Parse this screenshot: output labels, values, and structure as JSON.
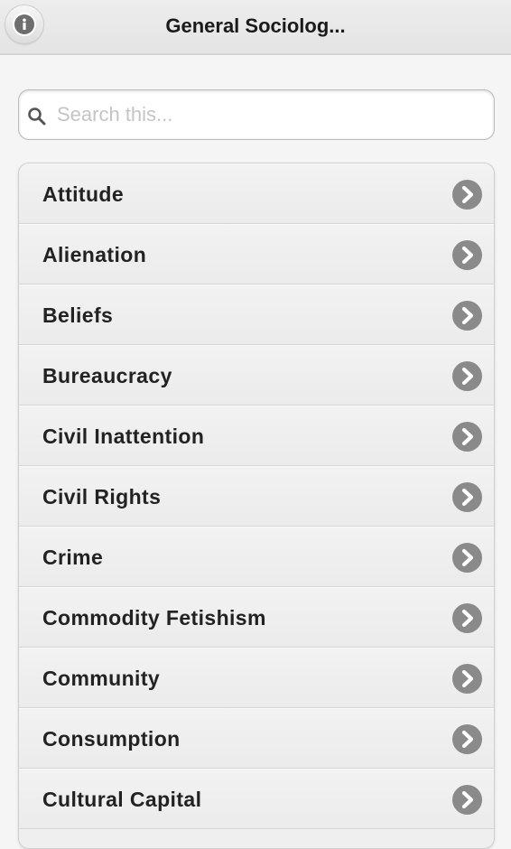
{
  "header": {
    "title": "General Sociolog...",
    "info_icon": "info-icon"
  },
  "search": {
    "placeholder": "Search this...",
    "value": "",
    "icon": "search-icon"
  },
  "list": {
    "chevron_icon": "chevron-right-icon",
    "items": [
      {
        "label": "Attitude"
      },
      {
        "label": "Alienation"
      },
      {
        "label": "Beliefs"
      },
      {
        "label": "Bureaucracy"
      },
      {
        "label": "Civil Inattention"
      },
      {
        "label": "Civil Rights"
      },
      {
        "label": "Crime"
      },
      {
        "label": "Commodity Fetishism"
      },
      {
        "label": "Community"
      },
      {
        "label": "Consumption"
      },
      {
        "label": "Cultural Capital"
      }
    ]
  },
  "colors": {
    "chevron": "#8a8a8a",
    "header_bg": "#e8e8e8",
    "page_bg": "#f5f5f5"
  }
}
